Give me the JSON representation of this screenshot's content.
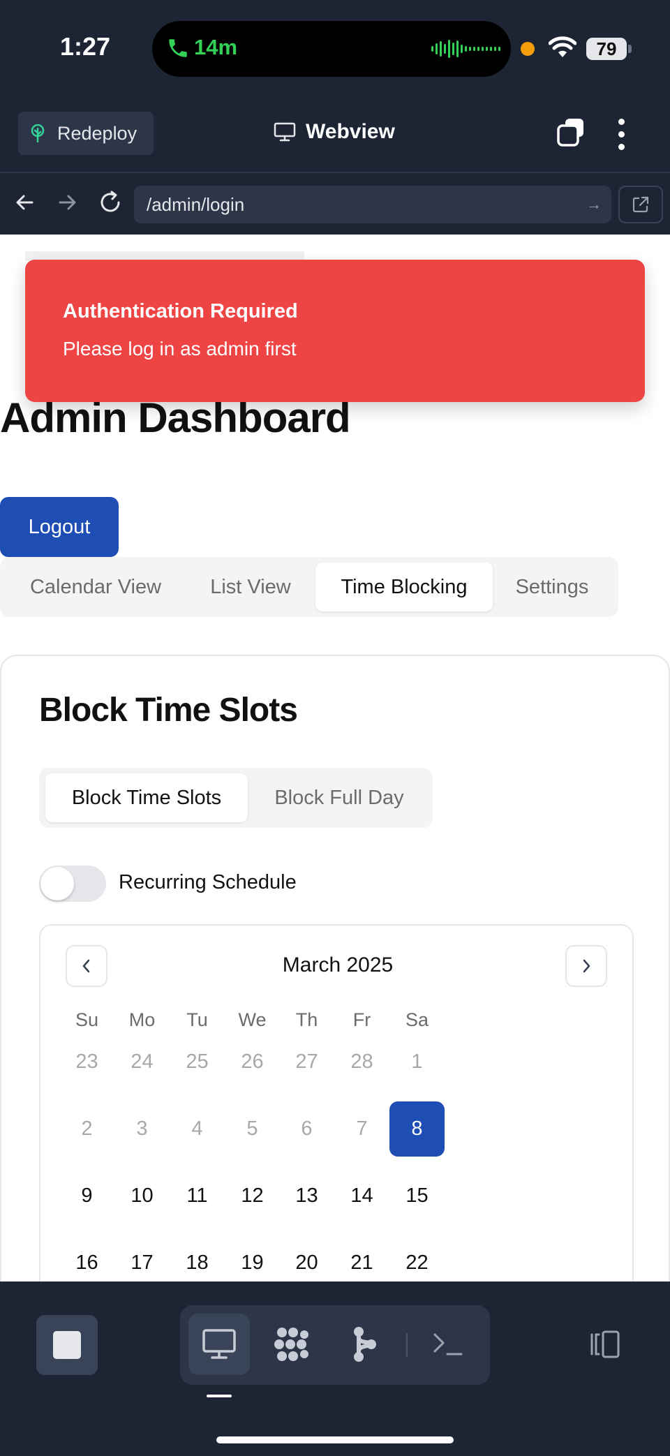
{
  "status_bar": {
    "time": "1:27",
    "call_duration": "14m",
    "battery": "79"
  },
  "toolbar": {
    "redeploy_label": "Redeploy",
    "webview_label": "Webview"
  },
  "url_bar": {
    "url": "/admin/login"
  },
  "toast": {
    "title": "Authentication Required",
    "description": "Please log in as admin first",
    "color": "#ef4444"
  },
  "page": {
    "title": "Admin Dashboard",
    "logout_label": "Logout",
    "view_tabs": [
      "Calendar View",
      "List View",
      "Time Blocking",
      "Settings"
    ],
    "active_view_tab": "Time Blocking"
  },
  "card": {
    "title": "Block Time Slots",
    "mode_tabs": [
      "Block Time Slots",
      "Block Full Day"
    ],
    "active_mode_tab": "Block Time Slots",
    "recurring_label": "Recurring Schedule",
    "recurring_on": false
  },
  "calendar": {
    "month_label": "March 2025",
    "weekdays": [
      "Su",
      "Mo",
      "Tu",
      "We",
      "Th",
      "Fr",
      "Sa"
    ],
    "weeks": [
      [
        "23",
        "24",
        "25",
        "26",
        "27",
        "28",
        "1"
      ],
      [
        "2",
        "3",
        "4",
        "5",
        "6",
        "7",
        "8"
      ],
      [
        "9",
        "10",
        "11",
        "12",
        "13",
        "14",
        "15"
      ],
      [
        "16",
        "17",
        "18",
        "19",
        "20",
        "21",
        "22"
      ]
    ],
    "muted_days": [
      "23",
      "24",
      "25",
      "26",
      "27",
      "28",
      "1",
      "2",
      "3",
      "4",
      "5",
      "6",
      "7"
    ],
    "selected_day": "8"
  },
  "colors": {
    "chrome_bg": "#1d2434",
    "primary": "#1e4db3",
    "accent_green": "#33d158"
  },
  "icons": {
    "call": "phone-icon",
    "redeploy": "tree-icon",
    "webview": "monitor-icon",
    "tabs": "tabs-icon",
    "more": "more-vertical-icon",
    "back": "arrow-left-icon",
    "forward": "arrow-right-icon",
    "reload": "reload-icon",
    "open_external": "external-link-icon",
    "stop": "stop-icon",
    "modes": [
      "monitor-icon",
      "hive-icon",
      "git-icon",
      "terminal-icon"
    ],
    "side_panel": "side-panel-icon"
  }
}
